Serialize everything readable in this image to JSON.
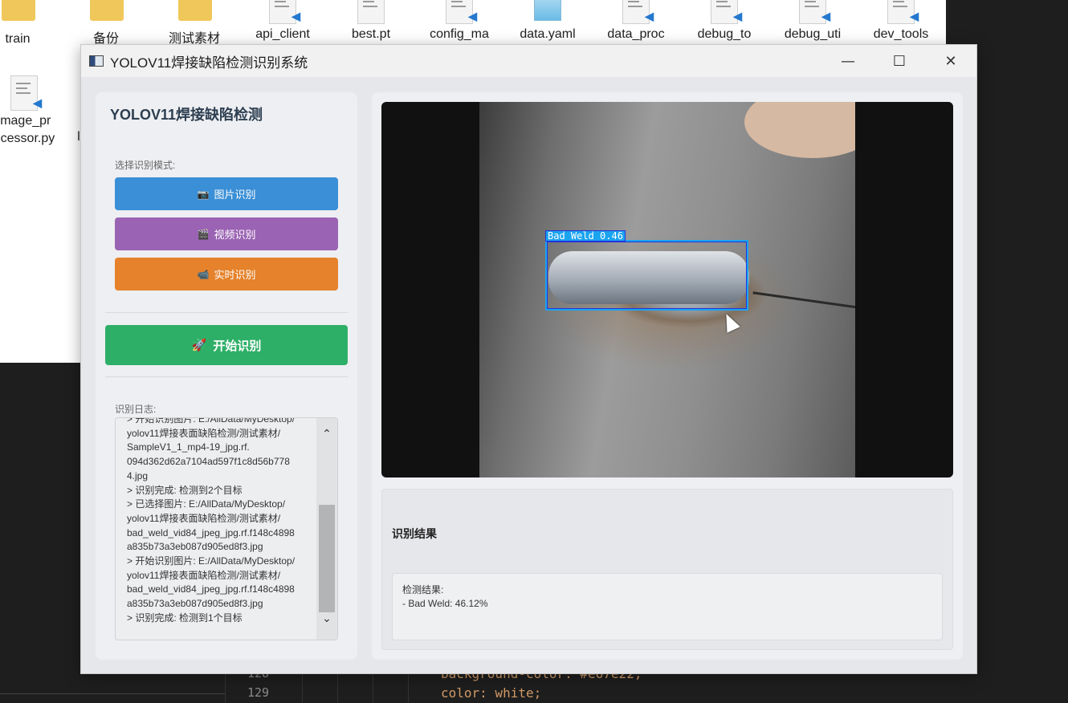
{
  "desktop": {
    "files_row1": [
      {
        "label": "train",
        "icon": "folder-icon"
      },
      {
        "label": "备份",
        "icon": "folder-icon"
      },
      {
        "label": "测试素材",
        "icon": "folder-icon"
      },
      {
        "label": "api_client",
        "icon": "python-file-icon"
      },
      {
        "label": "best.pt",
        "icon": "file-icon"
      },
      {
        "label": "config_ma",
        "icon": "python-file-icon"
      },
      {
        "label": "data.yaml",
        "icon": "notepad-file-icon"
      },
      {
        "label": "data_proc",
        "icon": "python-file-icon"
      },
      {
        "label": "debug_to",
        "icon": "python-file-icon"
      },
      {
        "label": "debug_uti",
        "icon": "python-file-icon"
      },
      {
        "label": "dev_tools",
        "icon": "python-file-icon"
      }
    ],
    "files_row2": [
      {
        "label_line1": "image_pr",
        "label_line2": "ocessor.py",
        "icon": "python-file-icon"
      }
    ],
    "stray_text": "l"
  },
  "editor": {
    "line_numbers": [
      "128",
      "129"
    ],
    "code_lines": [
      "background-color: #e67e22;",
      "color: white;"
    ]
  },
  "window": {
    "title": "YOLOV11焊接缺陷检测识别系统",
    "controls": {
      "minimize": "—",
      "maximize": "☐",
      "close": "✕"
    }
  },
  "left": {
    "app_title": "YOLOV11焊接缺陷检测",
    "mode_label": "选择识别模式:",
    "buttons": {
      "image": {
        "icon": "📷",
        "label": "图片识别",
        "color": "#3a8fd6"
      },
      "video": {
        "icon": "🎬",
        "label": "视频识别",
        "color": "#9b63b3"
      },
      "realtime": {
        "icon": "📹",
        "label": "实时识别",
        "color": "#e5822b"
      }
    },
    "start": {
      "icon": "🚀",
      "label": "开始识别",
      "color": "#2eaf67"
    },
    "log_label": "识别日志:",
    "log_lines": [
      "> 开始识别图片: E:/AllData/MyDesktop/",
      "yolov11焊接表面缺陷检测/测试素材/",
      "SampleV1_1_mp4-19_jpg.rf.",
      "094d362d62a7104ad597f1c8d56b778",
      "4.jpg",
      "> 识别完成: 检测到2个目标",
      "> 已选择图片: E:/AllData/MyDesktop/",
      "yolov11焊接表面缺陷检测/测试素材/",
      "bad_weld_vid84_jpeg_jpg.rf.f148c4898",
      "a835b73a3eb087d905ed8f3.jpg",
      "> 开始识别图片: E:/AllData/MyDesktop/",
      "yolov11焊接表面缺陷检测/测试素材/",
      "bad_weld_vid84_jpeg_jpg.rf.f148c4898",
      "a835b73a3eb087d905ed8f3.jpg",
      "> 识别完成: 检测到1个目标"
    ]
  },
  "right": {
    "detection_label": "Bad Weld 0.46",
    "result_title": "识别结果",
    "result_line1": "检测结果:",
    "result_line2": "- Bad Weld: 46.12%",
    "box_color": "#1aa4f0"
  }
}
